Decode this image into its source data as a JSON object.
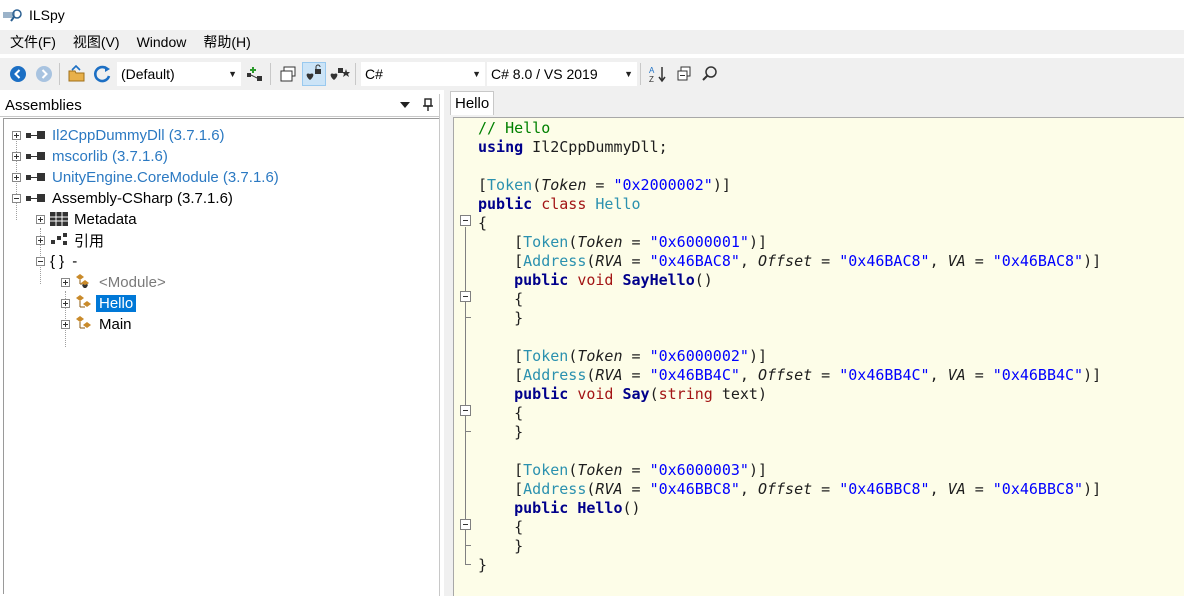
{
  "window": {
    "title": "ILSpy"
  },
  "menu": [
    "文件(F)",
    "视图(V)",
    "Window",
    "帮助(H)"
  ],
  "toolbar": {
    "assembly_list": "(Default)",
    "language": "C#",
    "language_version": "C# 8.0 / VS 2019"
  },
  "assemblies_panel": {
    "title": "Assemblies",
    "tree": [
      {
        "label": "Il2CppDummyDll (3.7.1.6)",
        "style": "blue"
      },
      {
        "label": "mscorlib (3.7.1.6)",
        "style": "blue"
      },
      {
        "label": "UnityEngine.CoreModule (3.7.1.6)",
        "style": "blue"
      },
      {
        "label": "Assembly-CSharp (3.7.1.6)",
        "style": "normal"
      },
      {
        "label": "Metadata",
        "style": "normal"
      },
      {
        "label": "引用",
        "style": "normal"
      },
      {
        "label": "-",
        "style": "normal",
        "icon_text": "{ }"
      },
      {
        "label": "<Module>",
        "style": "gray"
      },
      {
        "label": "Hello",
        "style": "selected"
      },
      {
        "label": "Main",
        "style": "normal"
      }
    ]
  },
  "editor": {
    "tab": "Hello",
    "lines": [
      [
        {
          "t": "// Hello",
          "c": "comment"
        }
      ],
      [
        {
          "t": "using",
          "c": "kw"
        },
        {
          "t": " Il2CppDummyDll;",
          "c": "ident"
        }
      ],
      [],
      [
        {
          "t": "[",
          "c": "ident"
        },
        {
          "t": "Token",
          "c": "attr"
        },
        {
          "t": "(",
          "c": "ident"
        },
        {
          "t": "Token",
          "c": "param"
        },
        {
          "t": " = ",
          "c": "ident"
        },
        {
          "t": "\"0x2000002\"",
          "c": "str"
        },
        {
          "t": ")]",
          "c": "ident"
        }
      ],
      [
        {
          "t": "public",
          "c": "kw"
        },
        {
          "t": " ",
          "c": "ident"
        },
        {
          "t": "class",
          "c": "type"
        },
        {
          "t": " ",
          "c": "ident"
        },
        {
          "t": "Hello",
          "c": "class"
        }
      ],
      [
        {
          "t": "{",
          "c": "ident"
        }
      ],
      [
        {
          "t": "    [",
          "c": "ident"
        },
        {
          "t": "Token",
          "c": "attr"
        },
        {
          "t": "(",
          "c": "ident"
        },
        {
          "t": "Token",
          "c": "param"
        },
        {
          "t": " = ",
          "c": "ident"
        },
        {
          "t": "\"0x6000001\"",
          "c": "str"
        },
        {
          "t": ")]",
          "c": "ident"
        }
      ],
      [
        {
          "t": "    [",
          "c": "ident"
        },
        {
          "t": "Address",
          "c": "attr"
        },
        {
          "t": "(",
          "c": "ident"
        },
        {
          "t": "RVA",
          "c": "param"
        },
        {
          "t": " = ",
          "c": "ident"
        },
        {
          "t": "\"0x46BAC8\"",
          "c": "str"
        },
        {
          "t": ", ",
          "c": "ident"
        },
        {
          "t": "Offset",
          "c": "param"
        },
        {
          "t": " = ",
          "c": "ident"
        },
        {
          "t": "\"0x46BAC8\"",
          "c": "str"
        },
        {
          "t": ", ",
          "c": "ident"
        },
        {
          "t": "VA",
          "c": "param"
        },
        {
          "t": " = ",
          "c": "ident"
        },
        {
          "t": "\"0x46BAC8\"",
          "c": "str"
        },
        {
          "t": ")]",
          "c": "ident"
        }
      ],
      [
        {
          "t": "    ",
          "c": "ident"
        },
        {
          "t": "public",
          "c": "kw"
        },
        {
          "t": " ",
          "c": "ident"
        },
        {
          "t": "void",
          "c": "type"
        },
        {
          "t": " ",
          "c": "ident"
        },
        {
          "t": "SayHello",
          "c": "kw"
        },
        {
          "t": "()",
          "c": "ident"
        }
      ],
      [
        {
          "t": "    {",
          "c": "ident"
        }
      ],
      [
        {
          "t": "    }",
          "c": "ident"
        }
      ],
      [],
      [
        {
          "t": "    [",
          "c": "ident"
        },
        {
          "t": "Token",
          "c": "attr"
        },
        {
          "t": "(",
          "c": "ident"
        },
        {
          "t": "Token",
          "c": "param"
        },
        {
          "t": " = ",
          "c": "ident"
        },
        {
          "t": "\"0x6000002\"",
          "c": "str"
        },
        {
          "t": ")]",
          "c": "ident"
        }
      ],
      [
        {
          "t": "    [",
          "c": "ident"
        },
        {
          "t": "Address",
          "c": "attr"
        },
        {
          "t": "(",
          "c": "ident"
        },
        {
          "t": "RVA",
          "c": "param"
        },
        {
          "t": " = ",
          "c": "ident"
        },
        {
          "t": "\"0x46BB4C\"",
          "c": "str"
        },
        {
          "t": ", ",
          "c": "ident"
        },
        {
          "t": "Offset",
          "c": "param"
        },
        {
          "t": " = ",
          "c": "ident"
        },
        {
          "t": "\"0x46BB4C\"",
          "c": "str"
        },
        {
          "t": ", ",
          "c": "ident"
        },
        {
          "t": "VA",
          "c": "param"
        },
        {
          "t": " = ",
          "c": "ident"
        },
        {
          "t": "\"0x46BB4C\"",
          "c": "str"
        },
        {
          "t": ")]",
          "c": "ident"
        }
      ],
      [
        {
          "t": "    ",
          "c": "ident"
        },
        {
          "t": "public",
          "c": "kw"
        },
        {
          "t": " ",
          "c": "ident"
        },
        {
          "t": "void",
          "c": "type"
        },
        {
          "t": " ",
          "c": "ident"
        },
        {
          "t": "Say",
          "c": "kw"
        },
        {
          "t": "(",
          "c": "ident"
        },
        {
          "t": "string",
          "c": "type"
        },
        {
          "t": " text)",
          "c": "ident"
        }
      ],
      [
        {
          "t": "    {",
          "c": "ident"
        }
      ],
      [
        {
          "t": "    }",
          "c": "ident"
        }
      ],
      [],
      [
        {
          "t": "    [",
          "c": "ident"
        },
        {
          "t": "Token",
          "c": "attr"
        },
        {
          "t": "(",
          "c": "ident"
        },
        {
          "t": "Token",
          "c": "param"
        },
        {
          "t": " = ",
          "c": "ident"
        },
        {
          "t": "\"0x6000003\"",
          "c": "str"
        },
        {
          "t": ")]",
          "c": "ident"
        }
      ],
      [
        {
          "t": "    [",
          "c": "ident"
        },
        {
          "t": "Address",
          "c": "attr"
        },
        {
          "t": "(",
          "c": "ident"
        },
        {
          "t": "RVA",
          "c": "param"
        },
        {
          "t": " = ",
          "c": "ident"
        },
        {
          "t": "\"0x46BBC8\"",
          "c": "str"
        },
        {
          "t": ", ",
          "c": "ident"
        },
        {
          "t": "Offset",
          "c": "param"
        },
        {
          "t": " = ",
          "c": "ident"
        },
        {
          "t": "\"0x46BBC8\"",
          "c": "str"
        },
        {
          "t": ", ",
          "c": "ident"
        },
        {
          "t": "VA",
          "c": "param"
        },
        {
          "t": " = ",
          "c": "ident"
        },
        {
          "t": "\"0x46BBC8\"",
          "c": "str"
        },
        {
          "t": ")]",
          "c": "ident"
        }
      ],
      [
        {
          "t": "    ",
          "c": "ident"
        },
        {
          "t": "public",
          "c": "kw"
        },
        {
          "t": " ",
          "c": "ident"
        },
        {
          "t": "Hello",
          "c": "kw"
        },
        {
          "t": "()",
          "c": "ident"
        }
      ],
      [
        {
          "t": "    {",
          "c": "ident"
        }
      ],
      [
        {
          "t": "    }",
          "c": "ident"
        }
      ],
      [
        {
          "t": "}",
          "c": "ident"
        }
      ]
    ]
  },
  "icons": {
    "back": "back-arrow-icon",
    "forward": "forward-arrow-icon",
    "open": "open-folder-icon",
    "refresh": "refresh-icon",
    "add_list": "add-assembly-list-icon",
    "new_window": "new-window-icon",
    "public_only": "show-public-only-icon",
    "show_all": "show-all-icon",
    "sort": "sort-az-icon",
    "collapse": "collapse-all-icon",
    "search": "search-icon"
  }
}
